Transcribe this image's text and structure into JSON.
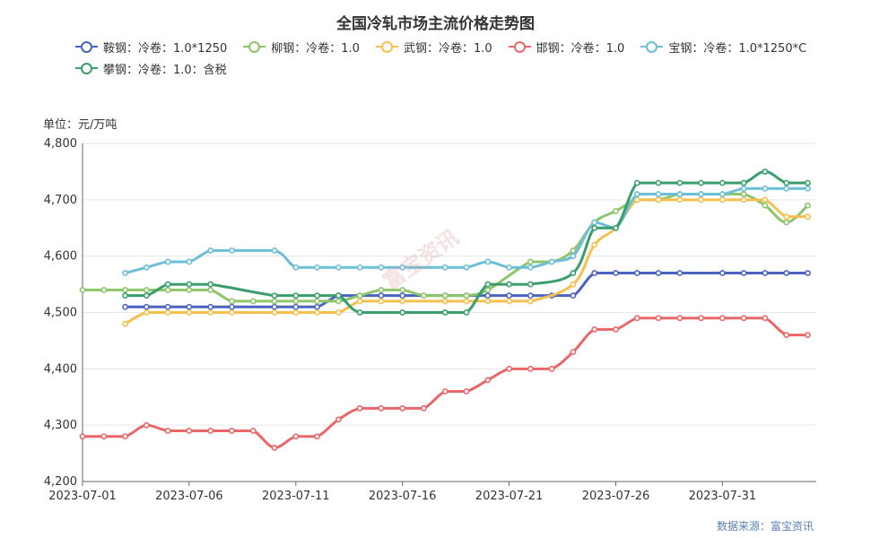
{
  "chart_data": {
    "type": "line",
    "title": "全国冷轧市场主流价格走势图",
    "unit_label": "单位：元/万吨",
    "source": "数据来源：富宝资讯",
    "watermark": "富宝资讯",
    "ylim": [
      4200,
      4800
    ],
    "yticks": [
      "4,200",
      "4,300",
      "4,400",
      "4,500",
      "4,600",
      "4,700",
      "4,800"
    ],
    "ytick_values": [
      4200,
      4300,
      4400,
      4500,
      4600,
      4700,
      4800
    ],
    "xtick_labels": [
      "2023-07-01",
      "2023-07-06",
      "2023-07-11",
      "2023-07-16",
      "2023-07-21",
      "2023-07-26",
      "2023-07-31"
    ],
    "xtick_days": [
      1,
      6,
      11,
      16,
      21,
      26,
      31
    ],
    "xlim": [
      1,
      35.4
    ],
    "grid": true,
    "legend_position": "top",
    "series": [
      {
        "name": "鞍钢：冷卷：1.0*1250",
        "color": "#4a63c0",
        "points": [
          [
            3,
            4510
          ],
          [
            4,
            4510
          ],
          [
            5,
            4510
          ],
          [
            6,
            4510
          ],
          [
            7,
            4510
          ],
          [
            8,
            4510
          ],
          [
            10,
            4510
          ],
          [
            11,
            4510
          ],
          [
            12,
            4510
          ],
          [
            13,
            4530
          ],
          [
            14,
            4530
          ],
          [
            15,
            4530
          ],
          [
            16,
            4530
          ],
          [
            18,
            4530
          ],
          [
            19,
            4530
          ],
          [
            20,
            4530
          ],
          [
            21,
            4530
          ],
          [
            22,
            4530
          ],
          [
            23,
            4530
          ],
          [
            24,
            4530
          ],
          [
            25,
            4570
          ],
          [
            26,
            4570
          ],
          [
            27,
            4570
          ],
          [
            28,
            4570
          ],
          [
            29,
            4570
          ],
          [
            31,
            4570
          ],
          [
            32,
            4570
          ],
          [
            33,
            4570
          ],
          [
            34,
            4570
          ],
          [
            35,
            4570
          ]
        ]
      },
      {
        "name": "柳钢：冷卷：1.0",
        "color": "#8cc56a",
        "points": [
          [
            1,
            4540
          ],
          [
            2,
            4540
          ],
          [
            3,
            4540
          ],
          [
            4,
            4540
          ],
          [
            5,
            4540
          ],
          [
            6,
            4540
          ],
          [
            7,
            4540
          ],
          [
            8,
            4520
          ],
          [
            9,
            4520
          ],
          [
            10,
            4520
          ],
          [
            11,
            4520
          ],
          [
            12,
            4520
          ],
          [
            13,
            4520
          ],
          [
            14,
            4530
          ],
          [
            15,
            4540
          ],
          [
            16,
            4540
          ],
          [
            17,
            4530
          ],
          [
            18,
            4530
          ],
          [
            19,
            4530
          ],
          [
            20,
            4540
          ],
          [
            22,
            4590
          ],
          [
            23,
            4590
          ],
          [
            24,
            4610
          ],
          [
            25,
            4660
          ],
          [
            26,
            4680
          ],
          [
            27,
            4700
          ],
          [
            28,
            4700
          ],
          [
            29,
            4710
          ],
          [
            30,
            4710
          ],
          [
            31,
            4710
          ],
          [
            32,
            4710
          ],
          [
            33,
            4690
          ],
          [
            34,
            4660
          ],
          [
            35,
            4690
          ]
        ]
      },
      {
        "name": "武钢：冷卷：1.0",
        "color": "#f5c04f",
        "points": [
          [
            3,
            4480
          ],
          [
            4,
            4500
          ],
          [
            5,
            4500
          ],
          [
            6,
            4500
          ],
          [
            7,
            4500
          ],
          [
            8,
            4500
          ],
          [
            10,
            4500
          ],
          [
            11,
            4500
          ],
          [
            12,
            4500
          ],
          [
            13,
            4500
          ],
          [
            14,
            4520
          ],
          [
            15,
            4520
          ],
          [
            16,
            4520
          ],
          [
            18,
            4520
          ],
          [
            19,
            4520
          ],
          [
            20,
            4520
          ],
          [
            21,
            4520
          ],
          [
            22,
            4520
          ],
          [
            24,
            4550
          ],
          [
            25,
            4620
          ],
          [
            26,
            4650
          ],
          [
            27,
            4700
          ],
          [
            28,
            4700
          ],
          [
            29,
            4700
          ],
          [
            30,
            4700
          ],
          [
            31,
            4700
          ],
          [
            32,
            4700
          ],
          [
            33,
            4700
          ],
          [
            34,
            4670
          ],
          [
            35,
            4670
          ]
        ]
      },
      {
        "name": "邯钢：冷卷：1.0",
        "color": "#e8686a",
        "points": [
          [
            1,
            4280
          ],
          [
            2,
            4280
          ],
          [
            3,
            4280
          ],
          [
            4,
            4300
          ],
          [
            5,
            4290
          ],
          [
            6,
            4290
          ],
          [
            7,
            4290
          ],
          [
            8,
            4290
          ],
          [
            9,
            4290
          ],
          [
            10,
            4260
          ],
          [
            11,
            4280
          ],
          [
            12,
            4280
          ],
          [
            13,
            4310
          ],
          [
            14,
            4330
          ],
          [
            15,
            4330
          ],
          [
            16,
            4330
          ],
          [
            17,
            4330
          ],
          [
            18,
            4360
          ],
          [
            19,
            4360
          ],
          [
            20,
            4380
          ],
          [
            21,
            4400
          ],
          [
            22,
            4400
          ],
          [
            23,
            4400
          ],
          [
            24,
            4430
          ],
          [
            25,
            4470
          ],
          [
            26,
            4470
          ],
          [
            27,
            4490
          ],
          [
            28,
            4490
          ],
          [
            29,
            4490
          ],
          [
            30,
            4490
          ],
          [
            31,
            4490
          ],
          [
            32,
            4490
          ],
          [
            33,
            4490
          ],
          [
            34,
            4460
          ],
          [
            35,
            4460
          ]
        ]
      },
      {
        "name": "宝钢：冷卷：1.0*1250*C",
        "color": "#6cbfd6",
        "points": [
          [
            3,
            4570
          ],
          [
            4,
            4580
          ],
          [
            5,
            4590
          ],
          [
            6,
            4590
          ],
          [
            7,
            4610
          ],
          [
            8,
            4610
          ],
          [
            10,
            4610
          ],
          [
            11,
            4580
          ],
          [
            12,
            4580
          ],
          [
            13,
            4580
          ],
          [
            14,
            4580
          ],
          [
            15,
            4580
          ],
          [
            16,
            4580
          ],
          [
            18,
            4580
          ],
          [
            19,
            4580
          ],
          [
            20,
            4590
          ],
          [
            21,
            4580
          ],
          [
            22,
            4580
          ],
          [
            23,
            4590
          ],
          [
            24,
            4600
          ],
          [
            25,
            4660
          ],
          [
            26,
            4650
          ],
          [
            27,
            4710
          ],
          [
            28,
            4710
          ],
          [
            29,
            4710
          ],
          [
            30,
            4710
          ],
          [
            31,
            4710
          ],
          [
            32,
            4720
          ],
          [
            33,
            4720
          ],
          [
            34,
            4720
          ],
          [
            35,
            4720
          ]
        ]
      },
      {
        "name": "攀钢：冷卷：1.0：含税",
        "color": "#3a9e6c",
        "points": [
          [
            3,
            4530
          ],
          [
            4,
            4530
          ],
          [
            5,
            4550
          ],
          [
            6,
            4550
          ],
          [
            7,
            4550
          ],
          [
            10,
            4530
          ],
          [
            11,
            4530
          ],
          [
            12,
            4530
          ],
          [
            13,
            4530
          ],
          [
            14,
            4500
          ],
          [
            16,
            4500
          ],
          [
            18,
            4500
          ],
          [
            19,
            4500
          ],
          [
            20,
            4550
          ],
          [
            21,
            4550
          ],
          [
            22,
            4550
          ],
          [
            24,
            4570
          ],
          [
            25,
            4650
          ],
          [
            26,
            4650
          ],
          [
            27,
            4730
          ],
          [
            28,
            4730
          ],
          [
            29,
            4730
          ],
          [
            30,
            4730
          ],
          [
            31,
            4730
          ],
          [
            32,
            4730
          ],
          [
            33,
            4750
          ],
          [
            34,
            4730
          ],
          [
            35,
            4730
          ]
        ]
      }
    ]
  }
}
